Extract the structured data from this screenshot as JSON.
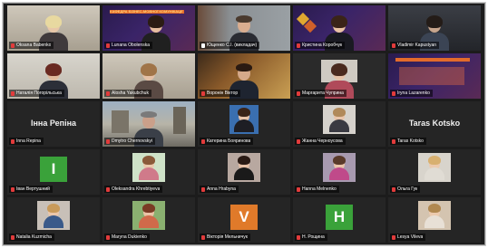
{
  "colors": {
    "tile_bg": "#252525",
    "active_border": "#e6e03a",
    "muted_mic": "#e23b3b",
    "avatar_green": "#3aa23a",
    "avatar_orange": "#e07a2a"
  },
  "participants": [
    {
      "name": "Oksana Babenko"
    },
    {
      "name": "Lunana Obolenska"
    },
    {
      "name": "Ющенко С.І. (викладач)"
    },
    {
      "name": "Кристина Коробчук"
    },
    {
      "name": "Vladimir Kapustyan"
    },
    {
      "name": "Наталія Погорільська"
    },
    {
      "name": "Alosha Yakubchuk"
    },
    {
      "name": "Воронін Віктор"
    },
    {
      "name": "Маргарита Чуприна"
    },
    {
      "name": "Iryna Lazarenko"
    },
    {
      "name": "Inna Repina",
      "display": "Інна Репіна"
    },
    {
      "name": "Dmytro Chernovskyi"
    },
    {
      "name": "Катерина Бояринова"
    },
    {
      "name": "Жанна Черноусова"
    },
    {
      "name": "Taras Kotsko",
      "display": "Taras Kotsko"
    },
    {
      "name": "Іван Вертушний",
      "avatar": "I"
    },
    {
      "name": "Oleksandra Khrebtiyeva"
    },
    {
      "name": "Anna Hrabyna"
    },
    {
      "name": "Hanna Melnenko"
    },
    {
      "name": "Ольга Гук"
    },
    {
      "name": "Natalia Kuzmicha"
    },
    {
      "name": "Maryna Dukienko"
    },
    {
      "name": "Вікторія Мельничук",
      "avatar": "V"
    },
    {
      "name": "H. Рощина",
      "avatar": "H"
    },
    {
      "name": "Lesya Vileva"
    }
  ],
  "slide_title": "КАФЕДРА БІЗНЕС-МОВНОЇ КОМУНІКАЦІЇ"
}
